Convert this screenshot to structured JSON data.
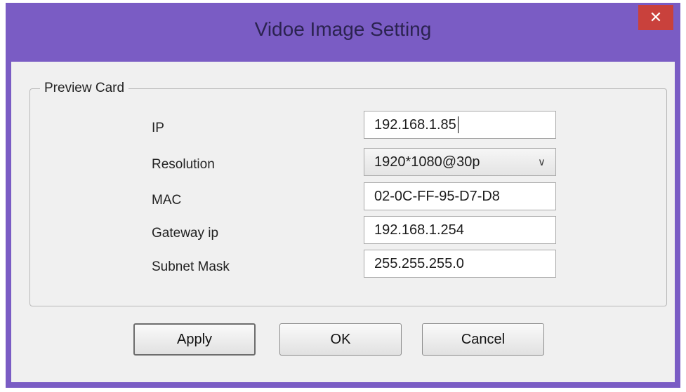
{
  "window": {
    "title": "Vidoe Image Setting",
    "close_label": "✕"
  },
  "group": {
    "legend": "Preview Card"
  },
  "fields": {
    "ip": {
      "label": "IP",
      "value": "192.168.1.85"
    },
    "resolution": {
      "label": "Resolution",
      "value": "1920*1080@30p"
    },
    "mac": {
      "label": "MAC",
      "value": "02-0C-FF-95-D7-D8"
    },
    "gateway": {
      "label": "Gateway ip",
      "value": "192.168.1.254"
    },
    "subnet": {
      "label": "Subnet Mask",
      "value": "255.255.255.0"
    }
  },
  "buttons": {
    "apply": "Apply",
    "ok": "OK",
    "cancel": "Cancel"
  },
  "colors": {
    "titlebar": "#7a5cc4",
    "close_button": "#c9413c",
    "client_background": "#f0f0f0"
  },
  "icons": {
    "close": "close-icon",
    "dropdown": "chevron-down-icon"
  }
}
